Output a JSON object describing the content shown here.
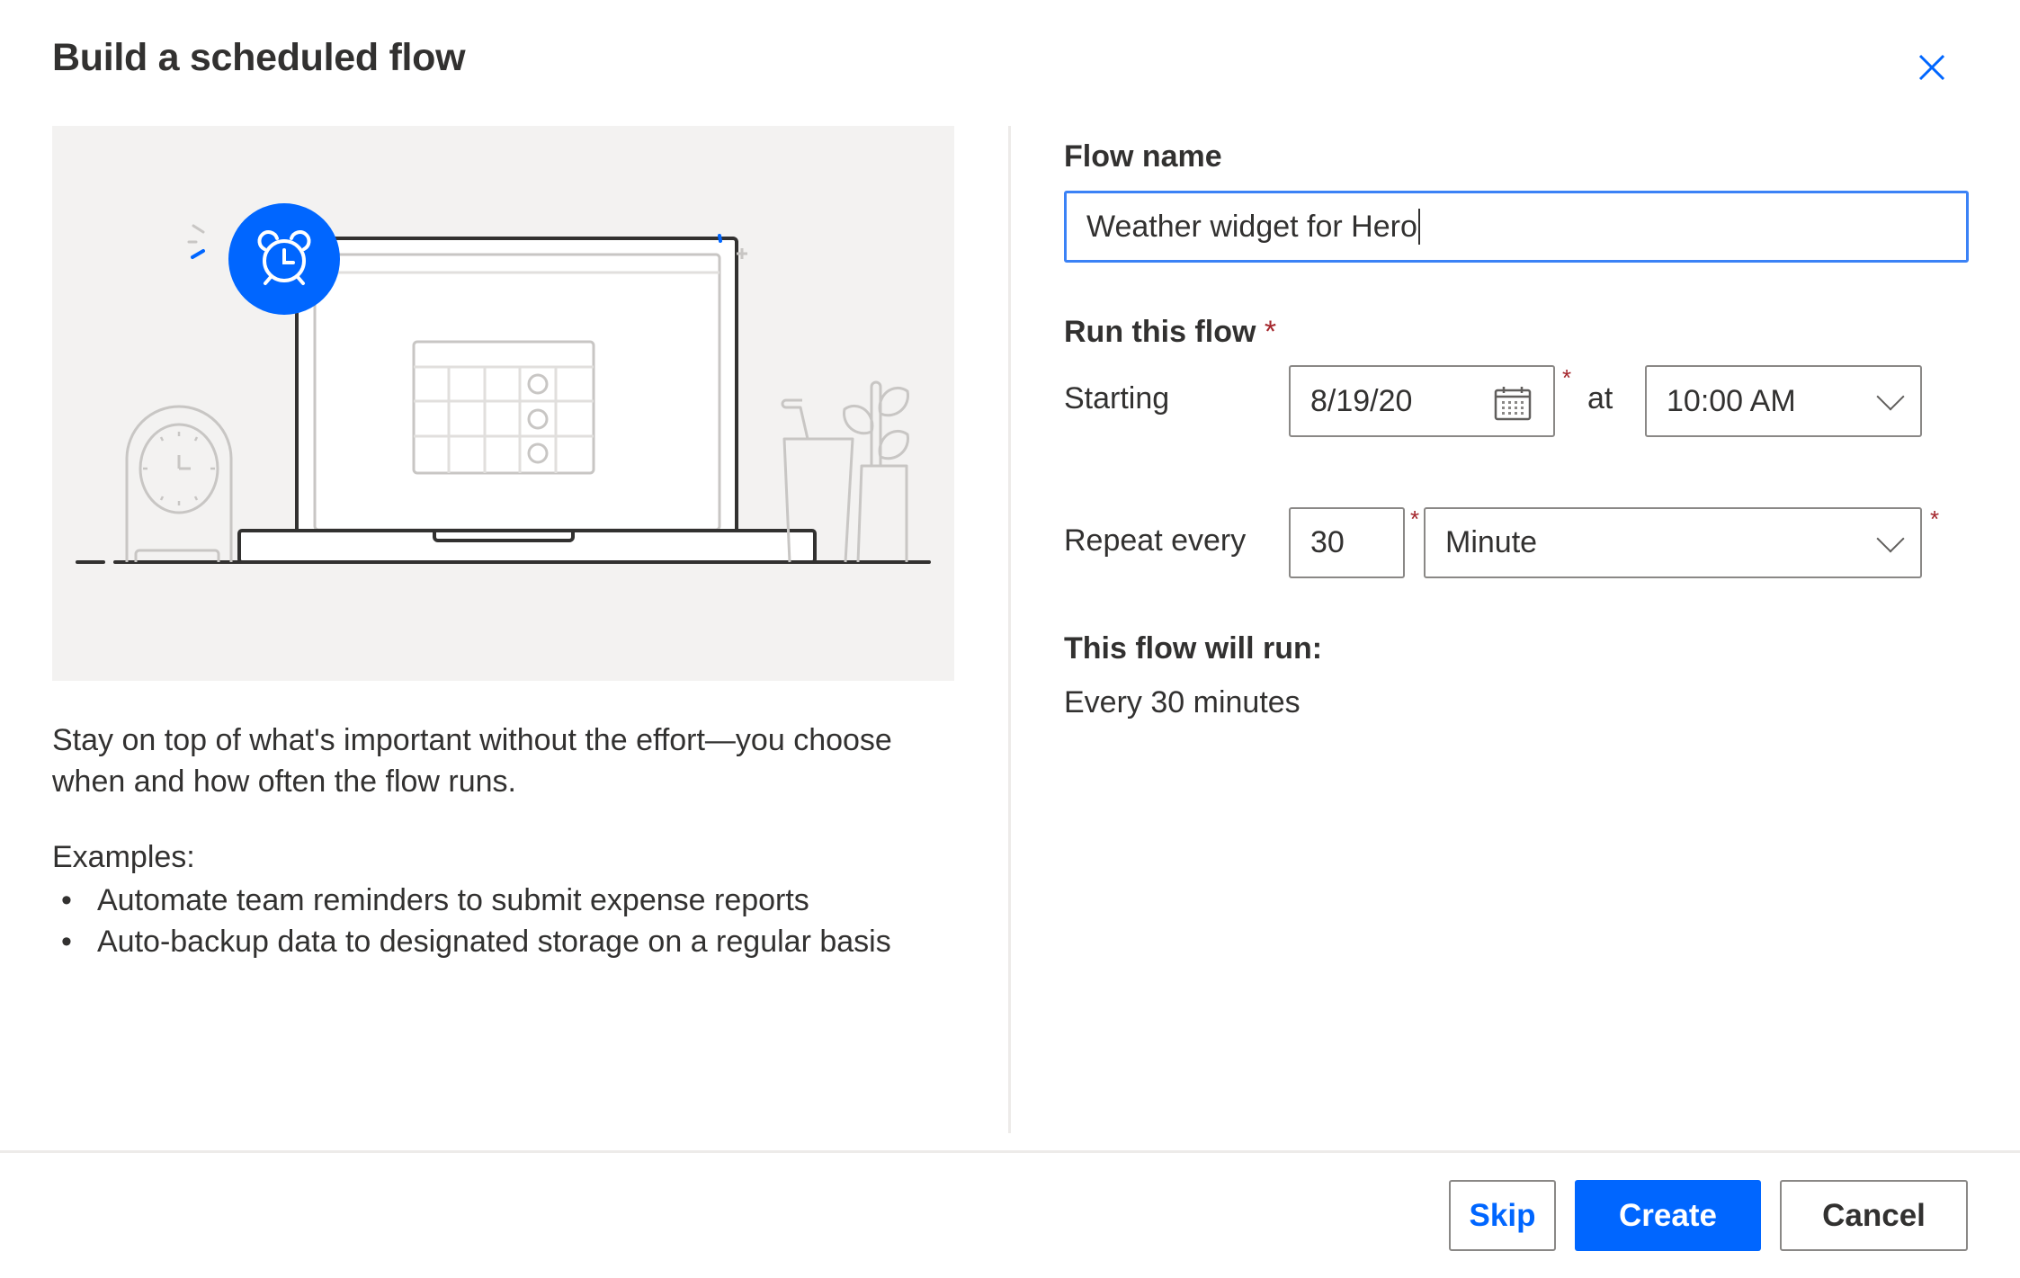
{
  "dialog": {
    "title": "Build a scheduled flow",
    "close_icon": "close-icon"
  },
  "left": {
    "illustration": {
      "description": "Laptop showing calendar with alarm clock badge, desk clock and plants",
      "badge_icon": "alarm-clock-icon"
    },
    "description": "Stay on top of what's important without the effort—you choose when and how often the flow runs.",
    "examples_label": "Examples:",
    "examples": [
      "Automate team reminders to submit expense reports",
      "Auto-backup data to designated storage on a regular basis"
    ]
  },
  "form": {
    "flow_name": {
      "label": "Flow name",
      "value": "Weather widget for Hero"
    },
    "run_this_flow": {
      "label": "Run this flow",
      "required_mark": "*"
    },
    "starting": {
      "label": "Starting",
      "date_value": "8/19/20",
      "date_icon": "calendar-icon",
      "at_label": "at",
      "time_value": "10:00 AM"
    },
    "repeat": {
      "label": "Repeat every",
      "interval_value": "30",
      "unit_value": "Minute"
    },
    "summary": {
      "label": "This flow will run:",
      "value": "Every 30 minutes"
    }
  },
  "footer": {
    "skip_label": "Skip",
    "create_label": "Create",
    "cancel_label": "Cancel"
  },
  "colors": {
    "accent": "#0066ff",
    "required": "#a4262c",
    "illustration_bg": "#f3f2f1"
  }
}
